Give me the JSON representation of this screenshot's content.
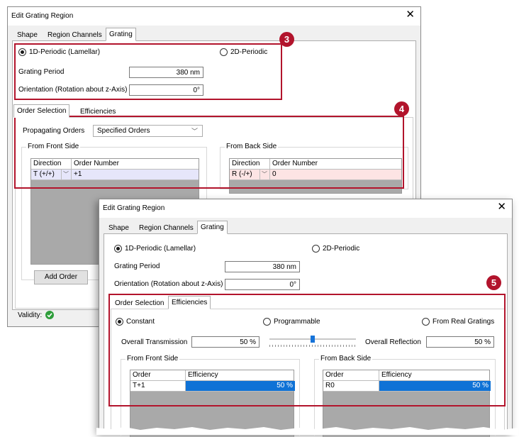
{
  "dialog_back": {
    "title": "Edit Grating Region",
    "tabs": [
      "Shape",
      "Region Channels",
      "Grating"
    ],
    "grating": {
      "radio_1d": "1D-Periodic (Lamellar)",
      "radio_2d": "2D-Periodic",
      "period_label": "Grating Period",
      "period_value": "380 nm",
      "orientation_label": "Orientation (Rotation about z-Axis)",
      "orientation_value": "0°"
    },
    "sub_tabs": [
      "Order Selection",
      "Efficiencies"
    ],
    "order_selection": {
      "propagating_label": "Propagating Orders",
      "propagating_value": "Specified Orders",
      "front": {
        "title": "From Front Side",
        "columns": [
          "Direction",
          "Order Number"
        ],
        "row": {
          "direction": "T (+/+)",
          "order": "+1"
        }
      },
      "back": {
        "title": "From Back Side",
        "columns": [
          "Direction",
          "Order Number"
        ],
        "row": {
          "direction": "R (-/+)",
          "order": "0"
        }
      },
      "add_order_button": "Add Order"
    },
    "validity_label": "Validity:"
  },
  "dialog_front": {
    "title": "Edit Grating Region",
    "tabs": [
      "Shape",
      "Region Channels",
      "Grating"
    ],
    "grating": {
      "radio_1d": "1D-Periodic (Lamellar)",
      "radio_2d": "2D-Periodic",
      "period_label": "Grating Period",
      "period_value": "380 nm",
      "orientation_label": "Orientation (Rotation about z-Axis)",
      "orientation_value": "0°"
    },
    "sub_tabs": [
      "Order Selection",
      "Efficiencies"
    ],
    "efficiencies": {
      "radio_constant": "Constant",
      "radio_programmable": "Programmable",
      "radio_real": "From Real Gratings",
      "transmission_label": "Overall Transmission",
      "transmission_value": "50 %",
      "reflection_label": "Overall Reflection",
      "reflection_value": "50 %",
      "slider_fraction": 0.5,
      "front": {
        "title": "From Front Side",
        "columns": [
          "Order",
          "Efficiency"
        ],
        "row": {
          "order": "T+1",
          "efficiency": "50 %"
        }
      },
      "back": {
        "title": "From Back Side",
        "columns": [
          "Order",
          "Efficiency"
        ],
        "row": {
          "order": "R0",
          "efficiency": "50 %"
        }
      }
    }
  },
  "callouts": [
    "3",
    "4",
    "5"
  ],
  "colors": {
    "callout": "#b2142c",
    "selection": "#0f72d6",
    "row_front_highlight": "#e6e6fa",
    "row_back_highlight": "#fde4e4",
    "validity_ok": "#2f9e3b"
  },
  "icons": [
    "close-icon",
    "chevron-down-icon",
    "checkmark-icon",
    "radio-checked-icon",
    "radio-unchecked-icon"
  ]
}
